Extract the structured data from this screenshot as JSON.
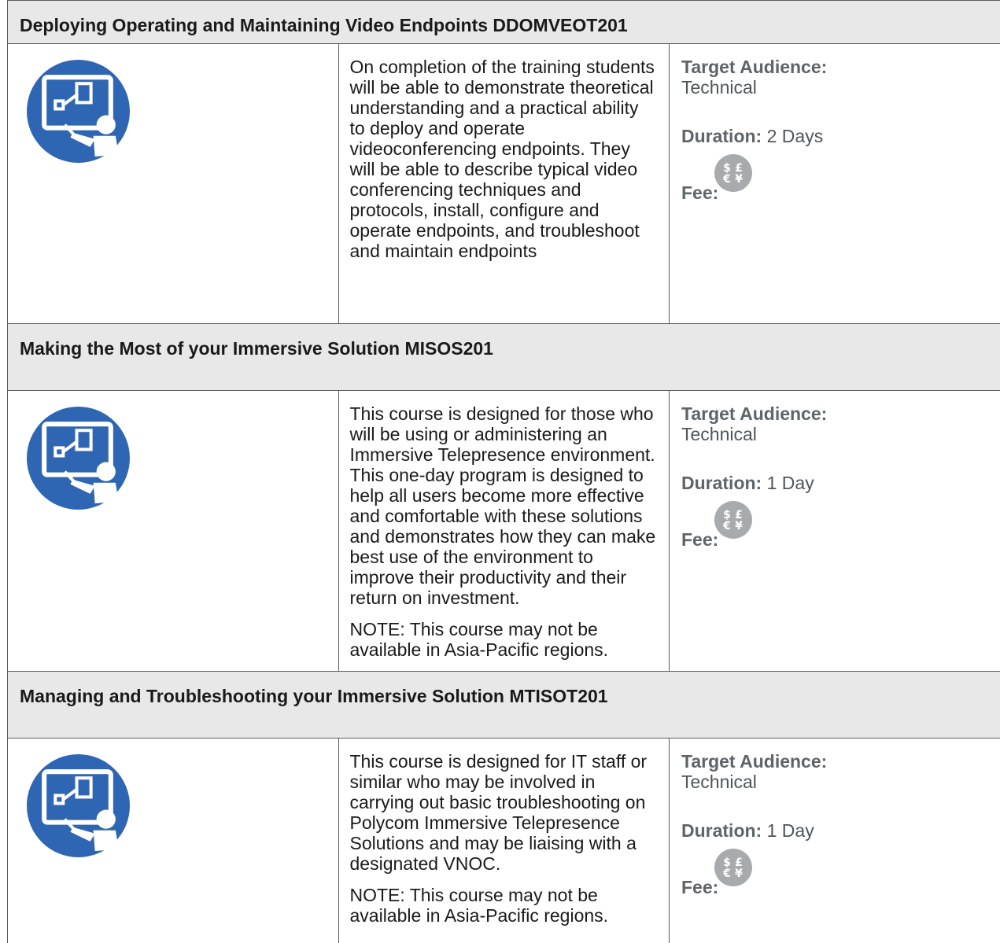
{
  "courses": [
    {
      "title": "Deploying Operating and Maintaining Video Endpoints DDOMVEOT201",
      "paragraphs": [
        "On completion of the training students will be able to demonstrate theoretical understanding and a practical ability to deploy and operate videoconferencing endpoints.  They will be able to describe typical video conferencing techniques and protocols, install, configure and operate endpoints, and troubleshoot and maintain endpoints"
      ],
      "target_label": "Target Audience:",
      "target_value": "Technical",
      "duration_label": "Duration:",
      "duration_value": " 2 Days",
      "fee_label": "Fee:",
      "fee_icon": "currency-icon"
    },
    {
      "title": "Making the Most of your Immersive Solution MISOS201",
      "paragraphs": [
        "This course is designed for those who will be using or administering an Immersive Telepresence environment. This one-day program is designed to help all users become more effective and comfortable with these solutions and demonstrates how they can make best use of the environment to improve their productivity and their return on investment.",
        "NOTE:  This course may not be available in Asia-Pacific regions."
      ],
      "target_label": "Target Audience:",
      "target_value": "Technical",
      "duration_label": "Duration:",
      "duration_value": " 1 Day",
      "fee_label": "Fee:",
      "fee_icon": "currency-icon"
    },
    {
      "title": "Managing and Troubleshooting your Immersive Solution MTISOT201",
      "paragraphs": [
        "This course is designed for IT staff or similar who may be involved in carrying out basic troubleshooting on Polycom Immersive Telepresence Solutions and may be liaising with a designated VNOC.",
        "NOTE:  This course may not be available in Asia-Pacific regions."
      ],
      "target_label": "Target Audience:",
      "target_value": "Technical",
      "duration_label": "Duration:",
      "duration_value": " 1 Day",
      "fee_label": "Fee:",
      "fee_icon": "currency-icon"
    }
  ],
  "colors": {
    "icon_blue": "#2f66b3",
    "fee_gray": "#a8abae",
    "title_bg": "#e8e8e8"
  },
  "fee_symbols": [
    "$",
    "£",
    "€",
    "¥"
  ]
}
